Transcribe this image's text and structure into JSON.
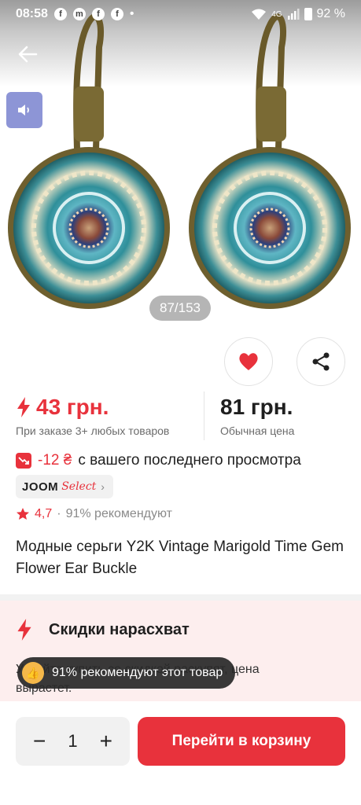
{
  "status_bar": {
    "time": "08:58",
    "network": "4G",
    "battery": "92 %"
  },
  "gallery": {
    "counter": "87/153"
  },
  "price": {
    "sale": "43 грн.",
    "sale_note": "При заказе 3+ любых товаров",
    "regular": "81 грн.",
    "regular_note": "Обычная цена"
  },
  "price_drop": {
    "amount": "-12 ₴",
    "text": "с вашего последнего просмотра"
  },
  "badge": {
    "brand": "JOOM",
    "select": "Select"
  },
  "rating": {
    "value": "4,7",
    "separator": "·",
    "recommend": "91% рекомендуют"
  },
  "product": {
    "title": "Модные серьги Y2K Vintage Marigold Time Gem Flower Ear Buckle"
  },
  "promo": {
    "title": "Скидки нарасхват",
    "text": "Успейте купить со скидкой раскупят, цена вырастет."
  },
  "toast": {
    "text": "91% рекомендуют этот товар"
  },
  "cart": {
    "quantity": "1",
    "minus": "−",
    "plus": "+",
    "button_label": "Перейти в корзину"
  },
  "colors": {
    "accent": "#e8323c",
    "promo_bg": "#fdeeee",
    "sound_btn": "#8d95d6"
  }
}
